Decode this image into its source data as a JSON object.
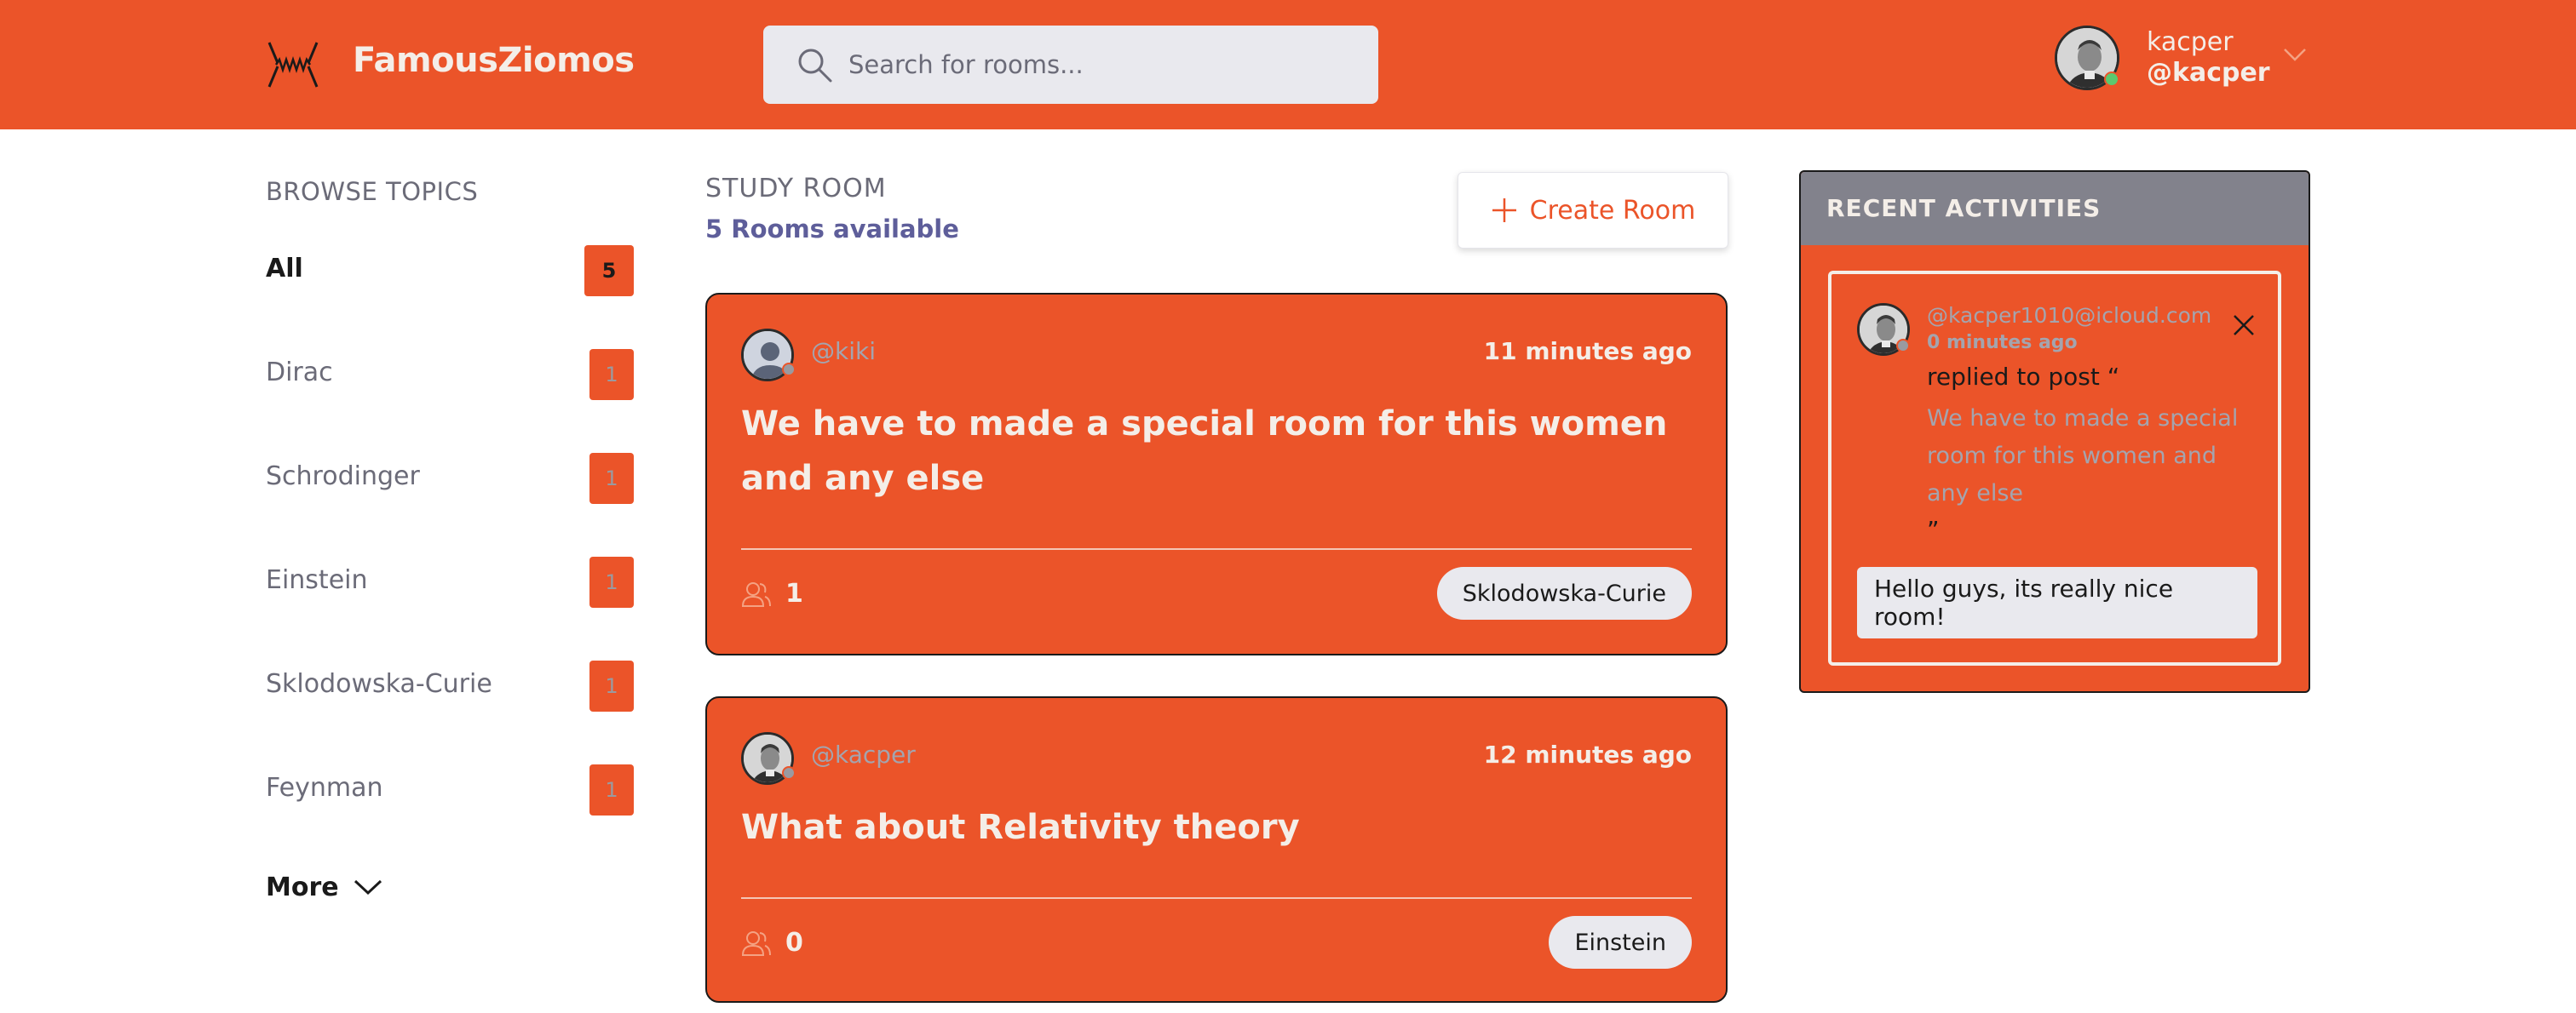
{
  "header": {
    "app_name": "FamousZiomos",
    "logo_icon": "spring-coil-logo-icon",
    "search": {
      "placeholder": "Search for rooms...",
      "value": ""
    },
    "user": {
      "name": "kacper",
      "handle": "@kacper",
      "status_color": "#5CC86E"
    }
  },
  "sidebar": {
    "title": "BROWSE TOPICS",
    "topics": [
      {
        "label": "All",
        "count": "5"
      },
      {
        "label": "Dirac",
        "count": "1"
      },
      {
        "label": "Schrodinger",
        "count": "1"
      },
      {
        "label": "Einstein",
        "count": "1"
      },
      {
        "label": "Sklodowska-Curie",
        "count": "1"
      },
      {
        "label": "Feynman",
        "count": "1"
      }
    ],
    "more_label": "More"
  },
  "main": {
    "title": "STUDY ROOM",
    "subtitle": "5 Rooms available",
    "create_label": "Create Room",
    "rooms": [
      {
        "host": "@kiki",
        "time": "11 minutes ago",
        "title": "We have to made a special room for this women and any else",
        "participants": "1",
        "topic": "Sklodowska-Curie"
      },
      {
        "host": "@kacper",
        "time": "12 minutes ago",
        "title": "What about Relativity theory",
        "participants": "0",
        "topic": "Einstein"
      }
    ]
  },
  "activities": {
    "title": "RECENT ACTIVITIES",
    "items": [
      {
        "user": "@kacper1010@icloud.com",
        "time": "0 minutes ago",
        "action": "replied to post “",
        "post": "We have to made a special room for this women and any else",
        "quote_end": "”",
        "message": "Hello guys, its really nice room!"
      }
    ]
  },
  "colors": {
    "accent": "#EB5429",
    "text_light": "#F4EEE8",
    "muted": "#6b6b78",
    "pill": "#E9E9EE",
    "panel_header": "#82828C"
  }
}
